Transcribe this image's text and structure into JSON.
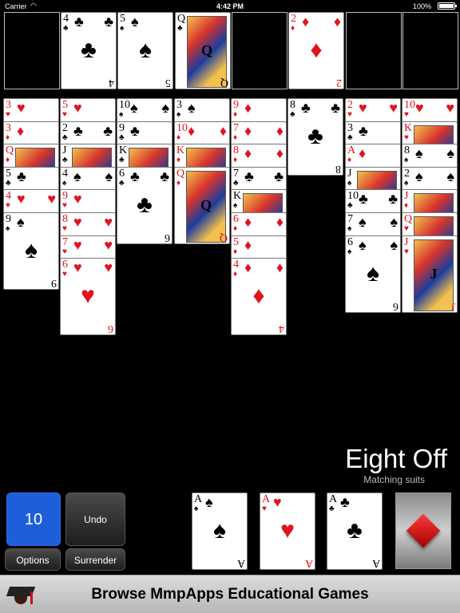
{
  "status_bar": {
    "carrier": "Carrier",
    "time": "4:42 PM",
    "battery": "100%"
  },
  "free_cells": [
    {
      "rank": "",
      "suit": "",
      "color": ""
    },
    {
      "rank": "4",
      "suit": "♣",
      "color": "black"
    },
    {
      "rank": "5",
      "suit": "♠",
      "color": "black"
    },
    {
      "rank": "Q",
      "suit": "♣",
      "color": "black"
    },
    {
      "rank": "",
      "suit": "",
      "color": ""
    },
    {
      "rank": "2",
      "suit": "♦",
      "color": "red"
    },
    {
      "rank": "",
      "suit": "",
      "color": ""
    },
    {
      "rank": "",
      "suit": "",
      "color": ""
    }
  ],
  "tableau": [
    [
      {
        "rank": "3",
        "suit": "♥"
      },
      {
        "rank": "3",
        "suit": "♦"
      },
      {
        "rank": "Q",
        "suit": "♦"
      },
      {
        "rank": "5",
        "suit": "♣"
      },
      {
        "rank": "4",
        "suit": "♥"
      },
      {
        "rank": "9",
        "suit": "♠"
      }
    ],
    [
      {
        "rank": "5",
        "suit": "♥"
      },
      {
        "rank": "2",
        "suit": "♣"
      },
      {
        "rank": "J",
        "suit": "♣"
      },
      {
        "rank": "4",
        "suit": "♠"
      },
      {
        "rank": "9",
        "suit": "♥"
      },
      {
        "rank": "8",
        "suit": "♥"
      },
      {
        "rank": "7",
        "suit": "♥"
      },
      {
        "rank": "6",
        "suit": "♥"
      }
    ],
    [
      {
        "rank": "10",
        "suit": "♠"
      },
      {
        "rank": "9",
        "suit": "♣"
      },
      {
        "rank": "K",
        "suit": "♣"
      },
      {
        "rank": "6",
        "suit": "♣"
      }
    ],
    [
      {
        "rank": "3",
        "suit": "♠"
      },
      {
        "rank": "10",
        "suit": "♦"
      },
      {
        "rank": "K",
        "suit": "♦"
      },
      {
        "rank": "Q",
        "suit": "♦"
      }
    ],
    [
      {
        "rank": "9",
        "suit": "♦"
      },
      {
        "rank": "7",
        "suit": "♦"
      },
      {
        "rank": "8",
        "suit": "♦"
      },
      {
        "rank": "7",
        "suit": "♣"
      },
      {
        "rank": "K",
        "suit": "♠"
      },
      {
        "rank": "6",
        "suit": "♦"
      },
      {
        "rank": "5",
        "suit": "♦"
      },
      {
        "rank": "4",
        "suit": "♦"
      }
    ],
    [
      {
        "rank": "8",
        "suit": "♣"
      }
    ],
    [
      {
        "rank": "2",
        "suit": "♥"
      },
      {
        "rank": "3",
        "suit": "♣"
      },
      {
        "rank": "A",
        "suit": "♦"
      },
      {
        "rank": "J",
        "suit": "♠"
      },
      {
        "rank": "10",
        "suit": "♣"
      },
      {
        "rank": "7",
        "suit": "♠"
      },
      {
        "rank": "6",
        "suit": "♠"
      }
    ],
    [
      {
        "rank": "10",
        "suit": "♥"
      },
      {
        "rank": "K",
        "suit": "♥"
      },
      {
        "rank": "8",
        "suit": "♠"
      },
      {
        "rank": "2",
        "suit": "♠"
      },
      {
        "rank": "J",
        "suit": "♦"
      },
      {
        "rank": "Q",
        "suit": "♥"
      },
      {
        "rank": "J",
        "suit": "♥"
      }
    ]
  ],
  "game": {
    "title": "Eight Off",
    "subtitle": "Matching suits"
  },
  "controls": {
    "moves": "10",
    "undo": "Undo",
    "options": "Options",
    "surrender": "Surrender"
  },
  "foundations": [
    {
      "rank": "A",
      "suit": "♠",
      "color": "black"
    },
    {
      "rank": "A",
      "suit": "♥",
      "color": "red"
    },
    {
      "rank": "A",
      "suit": "♣",
      "color": "black"
    }
  ],
  "draw_pile": {
    "icon": "diamond-icon",
    "color": "#e01414"
  },
  "banner": {
    "text": "Browse MmpApps Educational Games",
    "icon": "graduation-cap-icon"
  }
}
